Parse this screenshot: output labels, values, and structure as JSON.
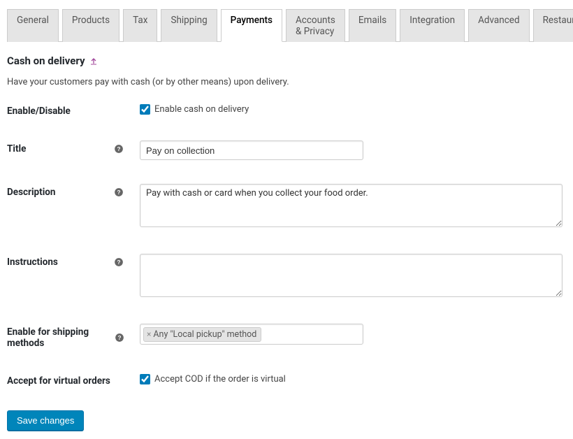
{
  "tabs": {
    "items": [
      {
        "label": "General"
      },
      {
        "label": "Products"
      },
      {
        "label": "Tax"
      },
      {
        "label": "Shipping"
      },
      {
        "label": "Payments"
      },
      {
        "label": "Accounts & Privacy"
      },
      {
        "label": "Emails"
      },
      {
        "label": "Integration"
      },
      {
        "label": "Advanced"
      },
      {
        "label": "Restaurant"
      }
    ],
    "active_index": 4
  },
  "section": {
    "title": "Cash on delivery",
    "description": "Have your customers pay with cash (or by other means) upon delivery."
  },
  "form": {
    "enable": {
      "label": "Enable/Disable",
      "checkbox_label": "Enable cash on delivery",
      "checked": true
    },
    "title": {
      "label": "Title",
      "value": "Pay on collection"
    },
    "description": {
      "label": "Description",
      "value": "Pay with cash or card when you collect your food order."
    },
    "instructions": {
      "label": "Instructions",
      "value": ""
    },
    "shipping_methods": {
      "label": "Enable for shipping methods",
      "selected_tag": "Any \"Local pickup\" method"
    },
    "virtual": {
      "label": "Accept for virtual orders",
      "checkbox_label": "Accept COD if the order is virtual",
      "checked": true
    }
  },
  "submit": {
    "save_label": "Save changes"
  }
}
